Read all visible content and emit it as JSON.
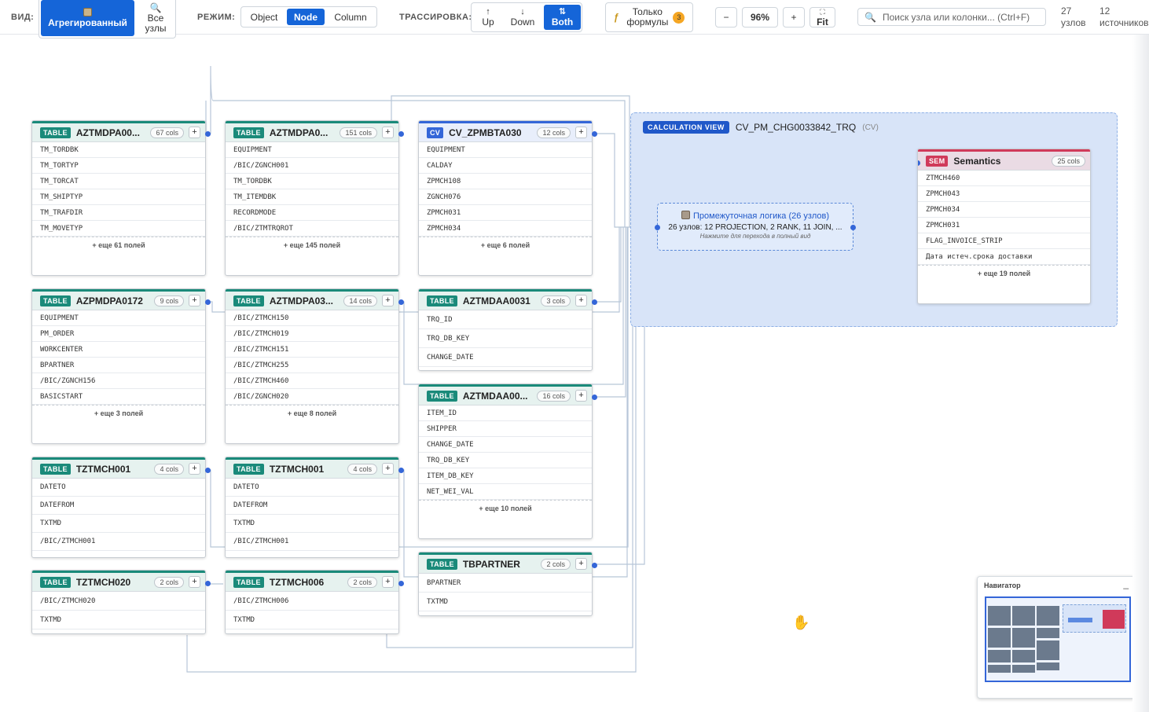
{
  "toolbar": {
    "view_label": "ВИД:",
    "view_aggregated": "Агрегированный",
    "view_all_1": "Все",
    "view_all_2": "узлы",
    "mode_label": "РЕЖИМ:",
    "mode_object": "Object",
    "mode_node": "Node",
    "mode_column": "Column",
    "trace_label": "ТРАССИРОВКА:",
    "trace_up": "Up",
    "trace_down": "Down",
    "trace_both": "Both",
    "formulas_1": "Только",
    "formulas_2": "формулы",
    "formulas_count": "3",
    "zoom_minus": "−",
    "zoom_value": "96%",
    "zoom_plus": "+",
    "fit": "Fit",
    "search_placeholder": "Поиск узла или колонки... (Ctrl+F)",
    "nodes_count": "27",
    "nodes_label": "узлов",
    "sources_count": "12",
    "sources_label": "источников"
  },
  "nodes": [
    {
      "tag": "TABLE",
      "name": "AZTMDPA00...",
      "cols": "67 cols",
      "fields": [
        "TM_TORDBK",
        "TM_TORTYP",
        "TM_TORCAT",
        "TM_SHIPTYP",
        "TM_TRAFDIR",
        "TM_MOVETYP"
      ],
      "more": "+ еще 61 полей"
    },
    {
      "tag": "TABLE",
      "name": "AZTMDPA0...",
      "cols": "151 cols",
      "fields": [
        "EQUIPMENT",
        "/BIC/ZGNCH001",
        "TM_TORDBK",
        "TM_ITEMDBK",
        "RECORDMODE",
        "/BIC/ZTMTRQROT"
      ],
      "more": "+ еще 145 полей"
    },
    {
      "tag": "CV",
      "name": "CV_ZPMBTA030",
      "cols": "12 cols",
      "fields": [
        "EQUIPMENT",
        "CALDAY",
        "ZPMCH108",
        "ZGNCH076",
        "ZPMCH031",
        "ZPMCH034"
      ],
      "more": "+ еще 6 полей"
    },
    {
      "tag": "TABLE",
      "name": "AZPMDPA0172",
      "cols": "9 cols",
      "fields": [
        "EQUIPMENT",
        "PM_ORDER",
        "WORKCENTER",
        "BPARTNER",
        "/BIC/ZGNCH156",
        "BASICSTART"
      ],
      "more": "+ еще 3 полей"
    },
    {
      "tag": "TABLE",
      "name": "AZTMDPA03...",
      "cols": "14 cols",
      "fields": [
        "/BIC/ZTMCH150",
        "/BIC/ZTMCH019",
        "/BIC/ZTMCH151",
        "/BIC/ZTMCH255",
        "/BIC/ZTMCH460",
        "/BIC/ZGNCH020"
      ],
      "more": "+ еще 8 полей"
    },
    {
      "tag": "TABLE",
      "name": "AZTMDAA0031",
      "cols": "3 cols",
      "fields": [
        "TRQ_ID",
        "TRQ_DB_KEY",
        "CHANGE_DATE"
      ],
      "more": ""
    },
    {
      "tag": "TABLE",
      "name": "AZTMDAA00...",
      "cols": "16 cols",
      "fields": [
        "ITEM_ID",
        "SHIPPER",
        "CHANGE_DATE",
        "TRQ_DB_KEY",
        "ITEM_DB_KEY",
        "NET_WEI_VAL"
      ],
      "more": "+ еще 10 полей"
    },
    {
      "tag": "TABLE",
      "name": "TZTMCH001",
      "cols": "4 cols",
      "fields": [
        "DATETO",
        "DATEFROM",
        "TXTMD",
        "/BIC/ZTMCH001"
      ],
      "more": ""
    },
    {
      "tag": "TABLE",
      "name": "TZTMCH001",
      "cols": "4 cols",
      "fields": [
        "DATETO",
        "DATEFROM",
        "TXTMD",
        "/BIC/ZTMCH001"
      ],
      "more": ""
    },
    {
      "tag": "TABLE",
      "name": "TBPARTNER",
      "cols": "2 cols",
      "fields": [
        "BPARTNER",
        "TXTMD"
      ],
      "more": ""
    },
    {
      "tag": "TABLE",
      "name": "TZTMCH020",
      "cols": "2 cols",
      "fields": [
        "/BIC/ZTMCH020",
        "TXTMD"
      ],
      "more": ""
    },
    {
      "tag": "TABLE",
      "name": "TZTMCH006",
      "cols": "2 cols",
      "fields": [
        "/BIC/ZTMCH006",
        "TXTMD"
      ],
      "more": ""
    }
  ],
  "calc_view": {
    "tag": "CALCULATION VIEW",
    "name": "CV_PM_CHG0033842_TRQ",
    "suffix": "(CV)",
    "intermediate_title": "Промежуточная логика (26 узлов)",
    "intermediate_detail": "26 узлов: 12 PROJECTION, 2 RANK, 11 JOIN, ...",
    "intermediate_hint": "Нажмите для перехода в полный вид",
    "semantics": {
      "tag": "SEM",
      "name": "Semantics",
      "cols": "25 cols",
      "fields": [
        "ZTMCH460",
        "ZPMCH043",
        "ZPMCH034",
        "ZPMCH031",
        "FLAG_INVOICE_STRIP",
        "Дата истеч.срока доставки"
      ],
      "more": "+ еще 19 полей"
    }
  },
  "navigator": {
    "title": "Навигатор",
    "collapse": "_"
  },
  "colors": {
    "accent": "#1565d8",
    "table": "#1a8a7a",
    "cv": "#3466d8",
    "sem": "#d03a5a",
    "group": "#d8e4f8"
  }
}
